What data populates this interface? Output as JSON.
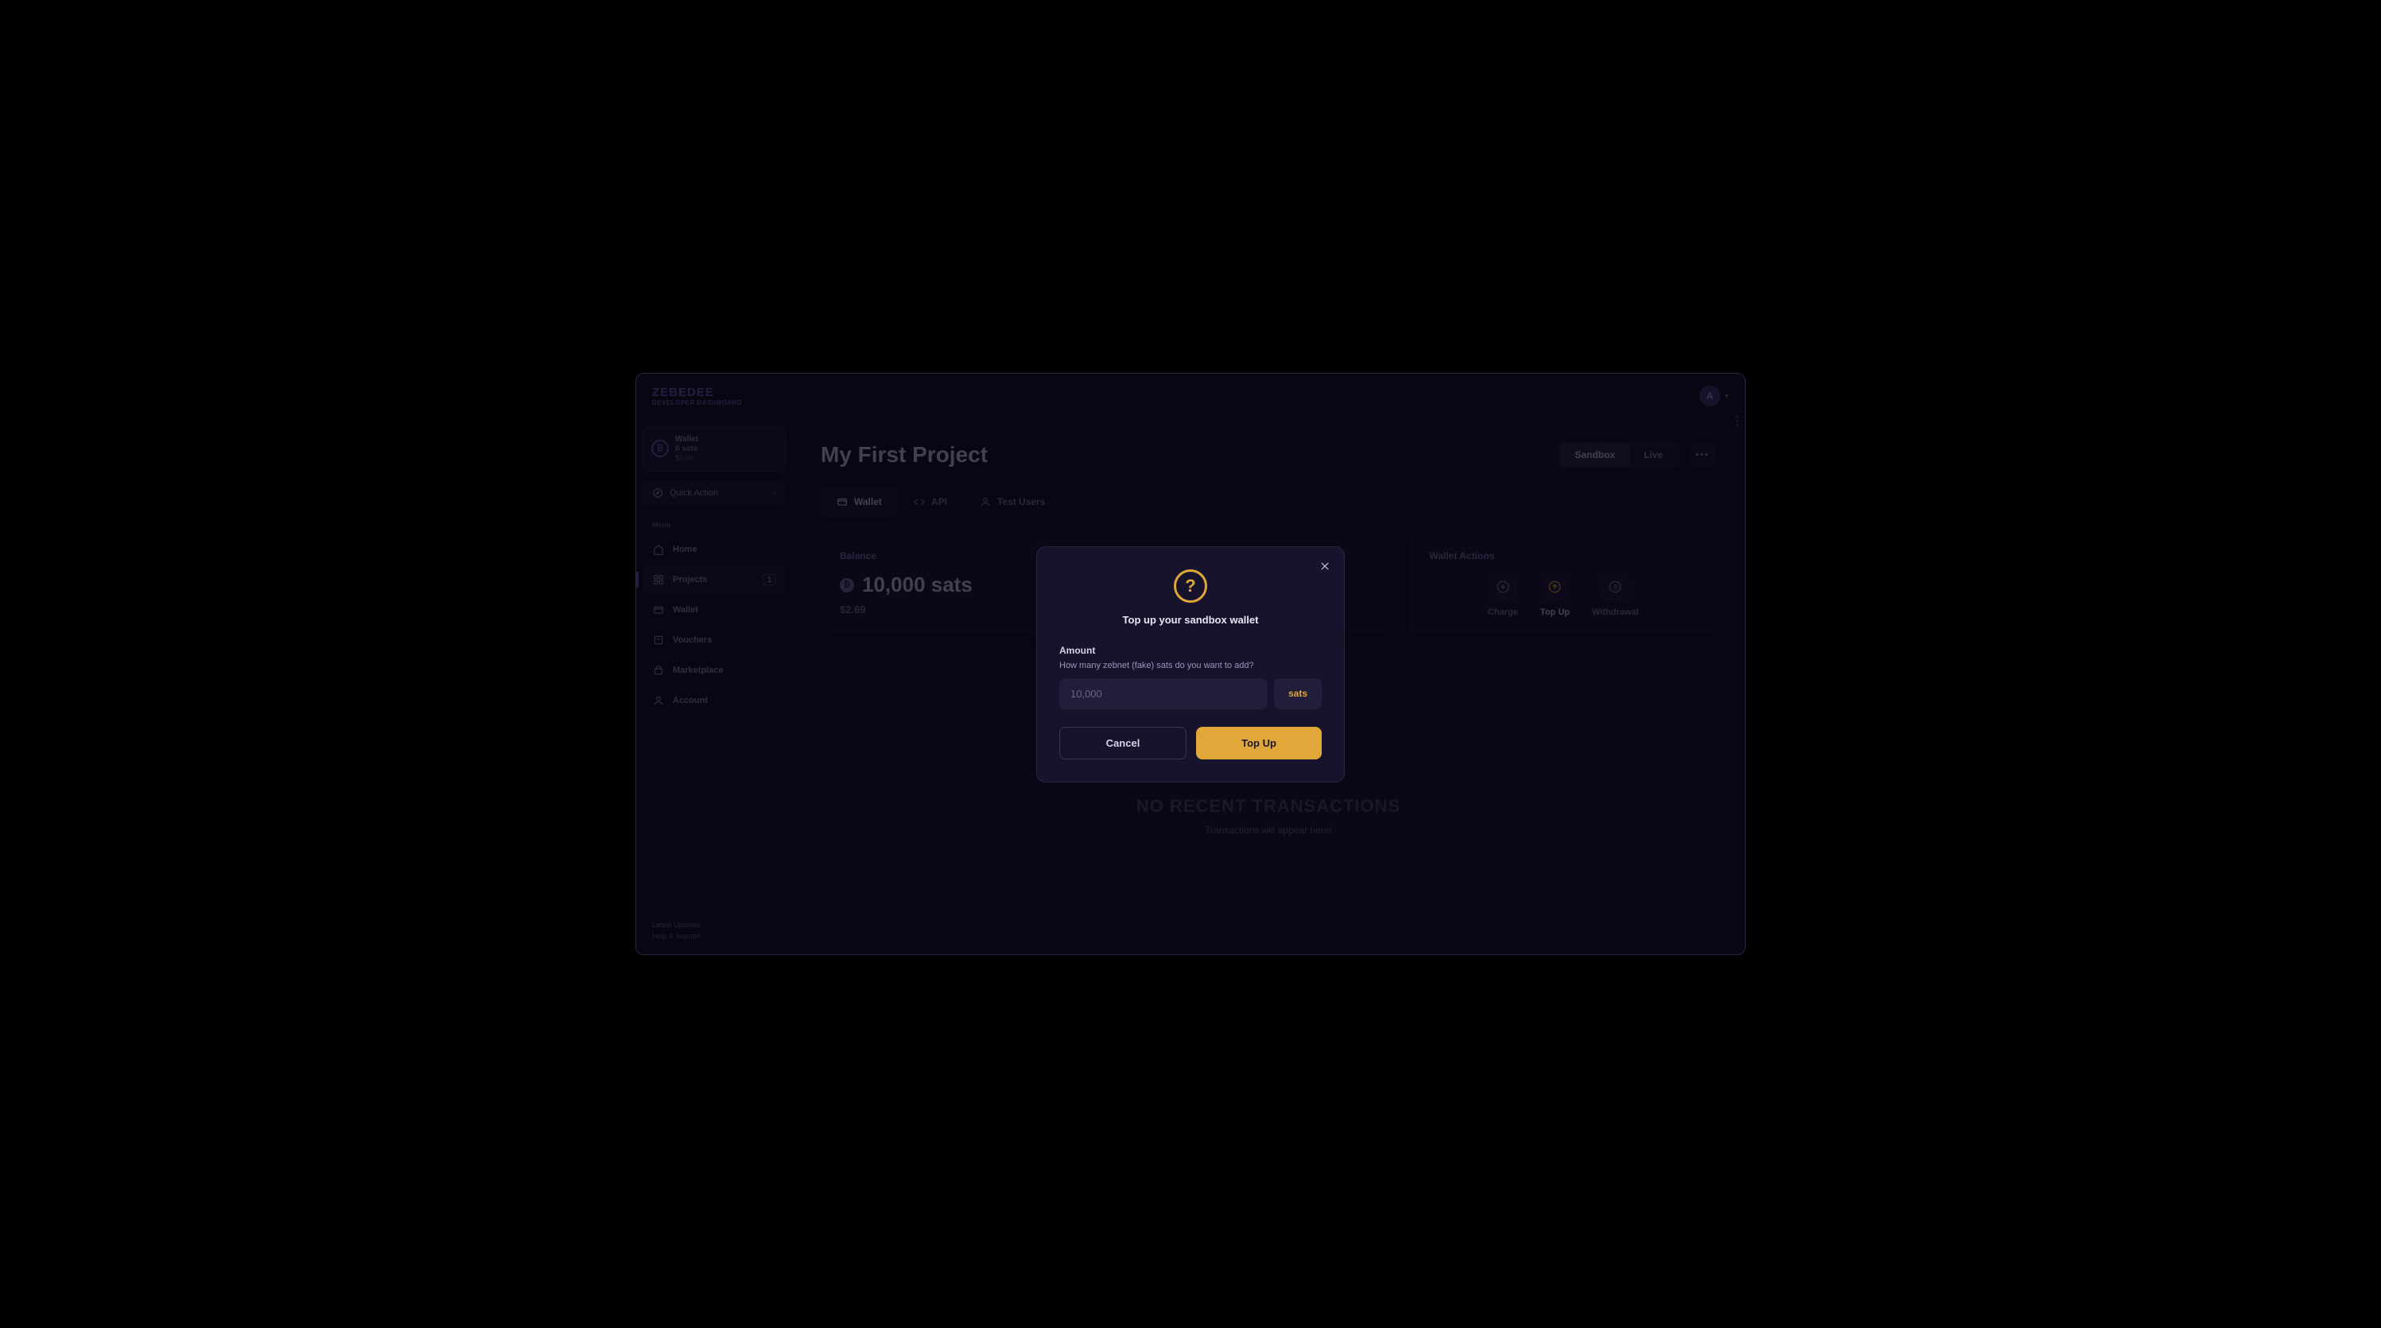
{
  "brand": {
    "title": "ZEBEDEE",
    "subtitle": "DEVELOPER DASHBOARD"
  },
  "user": {
    "initial": "A"
  },
  "sidebar": {
    "wallet": {
      "label": "Wallet",
      "sats": "0 sats",
      "usd": "$0.00"
    },
    "quick": "Quick Action",
    "menuLabel": "Menu",
    "items": [
      {
        "label": "Home"
      },
      {
        "label": "Projects",
        "badge": "1"
      },
      {
        "label": "Wallet"
      },
      {
        "label": "Vouchers"
      },
      {
        "label": "Marketplace"
      },
      {
        "label": "Account"
      }
    ],
    "footer": {
      "updates": "Latest Updates",
      "help": "Help & Support"
    }
  },
  "header": {
    "title": "My First Project",
    "toggle": {
      "sandbox": "Sandbox",
      "live": "Live"
    }
  },
  "tabs": {
    "wallet": "Wallet",
    "api": "API",
    "test": "Test Users"
  },
  "balance": {
    "label": "Balance",
    "value": "10,000 sats",
    "usd": "$2.69"
  },
  "actions": {
    "label": "Wallet Actions",
    "charge": "Charge",
    "topup": "Top Up",
    "withdrawal": "Withdrawal"
  },
  "empty": {
    "title": "NO RECENT TRANSACTIONS",
    "sub": "Transactions will appear here!"
  },
  "modal": {
    "title": "Top up your sandbox wallet",
    "amountLabel": "Amount",
    "hint": "How many zebnet (fake) sats do you want to add?",
    "placeholder": "10,000",
    "unit": "sats",
    "cancel": "Cancel",
    "confirm": "Top Up"
  }
}
